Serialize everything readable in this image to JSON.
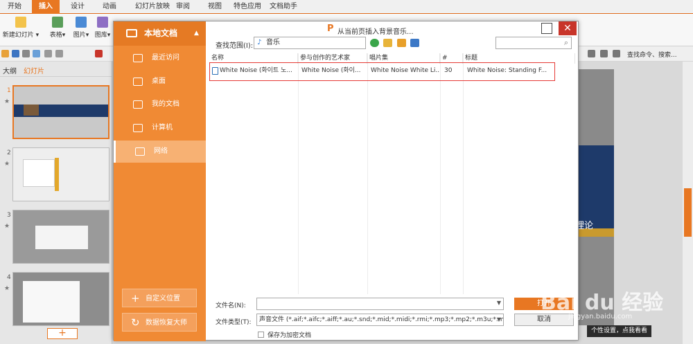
{
  "menubar": {
    "tabs": [
      "开始",
      "插入",
      "设计",
      "动画",
      "幻灯片放映",
      "审阅",
      "视图",
      "特色应用",
      "文档助手"
    ],
    "active": "插入"
  },
  "ribbon": {
    "new_slide": "新建幻灯片",
    "table": "表格",
    "picture": "图片",
    "gallery": "图库"
  },
  "quick_access": {
    "command_search": "查找命令、搜索..."
  },
  "left_pane": {
    "tab_outline": "大纲",
    "tab_slides": "幻灯片",
    "slide_numbers": [
      "1",
      "2",
      "3",
      "4"
    ],
    "add_slide": "+"
  },
  "canvas": {
    "visible_text": "理论"
  },
  "dialog": {
    "title": "从当前页插入背景音乐...",
    "sidebar": {
      "title": "本地文档",
      "items": [
        "最近访问",
        "桌面",
        "我的文档",
        "计算机",
        "网络"
      ],
      "selected": "网络",
      "custom_location": "自定义位置",
      "recovery": "数据恢复大师"
    },
    "lookin_label": "查找范围(I):",
    "lookin_value": "音乐",
    "columns": [
      "名称",
      "参与创作的艺术家",
      "唱片集",
      "#",
      "标题"
    ],
    "files": [
      {
        "name": "White Noise (화이트 노...",
        "artist": "White Noise (화이...",
        "album": "White Noise White Li...",
        "track": "30",
        "title": "White Noise: Standing F..."
      }
    ],
    "filename_label": "文件名(N):",
    "filename_value": "",
    "filetype_label": "文件类型(T):",
    "filetype_value": "声音文件 (*.aif;*.aifc;*.aiff;*.au;*.snd;*.mid;*.midi;*.rmi;*.mp3;*.mp2;*.m3u;*.m4a;*.wav",
    "encrypt_label": "保存为加密文档",
    "open_button": "打开",
    "cancel_button": "取消"
  },
  "tooltip": "个性设置，点我看看",
  "watermark": {
    "brand": "Bai du 经验",
    "url": "jingyan.baidu.com"
  },
  "colors": {
    "accent": "#e87722",
    "sidebar": "#f08a34",
    "close": "#c8352a",
    "highlight": "#e53935"
  }
}
